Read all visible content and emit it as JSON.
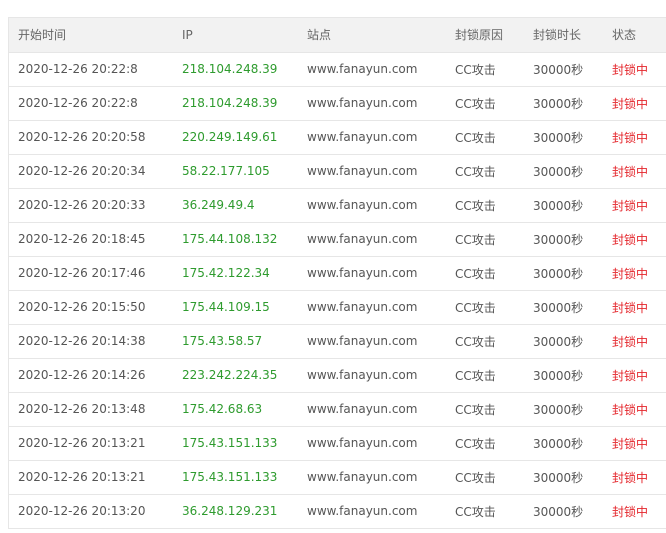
{
  "table": {
    "headers": [
      "开始时间",
      "IP",
      "站点",
      "封锁原因",
      "封锁时长",
      "状态"
    ],
    "rows": [
      [
        "2020-12-26 20:22:8",
        "218.104.248.39",
        "www.fanayun.com",
        "CC攻击",
        "30000秒",
        "封锁中"
      ],
      [
        "2020-12-26 20:22:8",
        "218.104.248.39",
        "www.fanayun.com",
        "CC攻击",
        "30000秒",
        "封锁中"
      ],
      [
        "2020-12-26 20:20:58",
        "220.249.149.61",
        "www.fanayun.com",
        "CC攻击",
        "30000秒",
        "封锁中"
      ],
      [
        "2020-12-26 20:20:34",
        "58.22.177.105",
        "www.fanayun.com",
        "CC攻击",
        "30000秒",
        "封锁中"
      ],
      [
        "2020-12-26 20:20:33",
        "36.249.49.4",
        "www.fanayun.com",
        "CC攻击",
        "30000秒",
        "封锁中"
      ],
      [
        "2020-12-26 20:18:45",
        "175.44.108.132",
        "www.fanayun.com",
        "CC攻击",
        "30000秒",
        "封锁中"
      ],
      [
        "2020-12-26 20:17:46",
        "175.42.122.34",
        "www.fanayun.com",
        "CC攻击",
        "30000秒",
        "封锁中"
      ],
      [
        "2020-12-26 20:15:50",
        "175.44.109.15",
        "www.fanayun.com",
        "CC攻击",
        "30000秒",
        "封锁中"
      ],
      [
        "2020-12-26 20:14:38",
        "175.43.58.57",
        "www.fanayun.com",
        "CC攻击",
        "30000秒",
        "封锁中"
      ],
      [
        "2020-12-26 20:14:26",
        "223.242.224.35",
        "www.fanayun.com",
        "CC攻击",
        "30000秒",
        "封锁中"
      ],
      [
        "2020-12-26 20:13:48",
        "175.42.68.63",
        "www.fanayun.com",
        "CC攻击",
        "30000秒",
        "封锁中"
      ],
      [
        "2020-12-26 20:13:21",
        "175.43.151.133",
        "www.fanayun.com",
        "CC攻击",
        "30000秒",
        "封锁中"
      ],
      [
        "2020-12-26 20:13:21",
        "175.43.151.133",
        "www.fanayun.com",
        "CC攻击",
        "30000秒",
        "封锁中"
      ],
      [
        "2020-12-26 20:13:20",
        "36.248.129.231",
        "www.fanayun.com",
        "CC攻击",
        "30000秒",
        "封锁中"
      ]
    ]
  },
  "colors": {
    "ip_text": "#2e9b2e",
    "status_text": "#e4252b",
    "header_bg": "#f2f2f2",
    "border": "#e6e6e6"
  }
}
